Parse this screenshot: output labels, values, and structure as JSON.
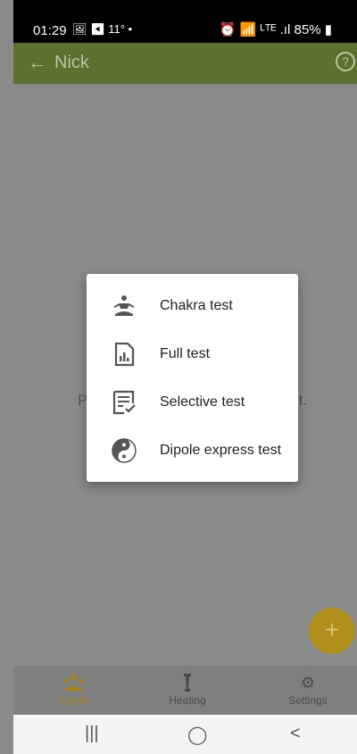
{
  "status_bar": {
    "time": "01:29",
    "left_icons": "🖼 ◀ 11° •",
    "right_icons": "⏰ 📶 ᴸᵀᴱ .ıl",
    "battery": "85%"
  },
  "app_bar": {
    "title": "Nick",
    "back_icon": "←",
    "help_icon": "?"
  },
  "content": {
    "hint_left": "P",
    "hint_right": "t."
  },
  "dialog": {
    "items": [
      {
        "label": "Chakra test",
        "icon": "meditation-icon"
      },
      {
        "label": "Full test",
        "icon": "report-icon"
      },
      {
        "label": "Selective test",
        "icon": "checklist-icon"
      },
      {
        "label": "Dipole express test",
        "icon": "yin-yang-icon"
      }
    ]
  },
  "fab": {
    "label": "+"
  },
  "bottom_nav": {
    "items": [
      {
        "label": "Cards",
        "icon": "people-icon",
        "active": true
      },
      {
        "label": "Heating",
        "icon": "heater-icon",
        "active": false
      },
      {
        "label": "Settings",
        "icon": "gear-icon",
        "active": false
      }
    ]
  },
  "system_nav": {
    "recents": "|||",
    "home": "◯",
    "back": "<"
  },
  "colors": {
    "app_bar": "#5a712f",
    "accent": "#a8861e",
    "scrim": "#8a8a8a"
  }
}
